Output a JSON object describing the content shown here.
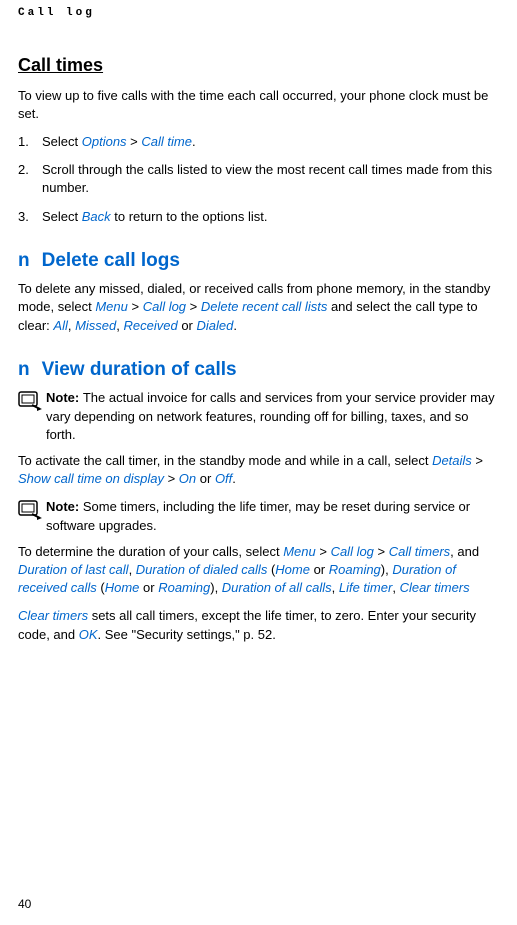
{
  "header": {
    "label": "Call log"
  },
  "sectionCallTimes": {
    "title": "Call times",
    "intro": "To view up to five calls with the time each call occurred, your phone clock must be set.",
    "steps": {
      "s1a": "Select ",
      "s1_options": "Options",
      "s1_gt": " > ",
      "s1_calltime": "Call time",
      "s1b": ".",
      "s2": "Scroll through the calls listed to view the most recent call times made from this number.",
      "s3a": "Select ",
      "s3_back": "Back",
      "s3b": " to return to the options list."
    }
  },
  "sectionDelete": {
    "bullet": "n",
    "title": "Delete call logs",
    "p1a": "To delete any missed, dialed, or received calls from phone memory, in the standby mode, select ",
    "p1_menu": "Menu",
    "p1_gt1": " > ",
    "p1_calllog": "Call log",
    "p1_gt2": " > ",
    "p1_delete": "Delete recent call lists",
    "p1b": " and select the call type to clear: ",
    "p1_all": "All",
    "p1_c1": ", ",
    "p1_missed": "Missed",
    "p1_c2": ", ",
    "p1_received": "Received",
    "p1_or": " or ",
    "p1_dialed": "Dialed",
    "p1c": "."
  },
  "sectionDuration": {
    "bullet": "n",
    "title": "View duration of calls",
    "note1_label": "Note: ",
    "note1_text": "The actual invoice for calls and services from your service provider may vary depending on network features, rounding off for billing, taxes, and so forth.",
    "p1a": "To activate the call timer, in the standby mode and while in a call, select ",
    "p1_details": "Details",
    "p1_gt1": " > ",
    "p1_show": "Show call time on display",
    "p1_gt2": " > ",
    "p1_on": "On",
    "p1_or": " or ",
    "p1_off": "Off",
    "p1b": ".",
    "note2_label": "Note: ",
    "note2_text": "Some timers, including the life timer, may be reset during service or software upgrades.",
    "p2a": "To determine the duration of your calls, select ",
    "p2_menu": "Menu",
    "p2_gt1": " > ",
    "p2_calllog": "Call log",
    "p2_gt2": " > ",
    "p2_timers": "Call timers",
    "p2b": ", and ",
    "p2_last": "Duration of last call",
    "p2_c1": ", ",
    "p2_dialed": "Duration of dialed calls",
    "p2_lp1": " (",
    "p2_home1": "Home",
    "p2_or1": " or ",
    "p2_roam1": "Roaming",
    "p2_rp1": "), ",
    "p2_recv": "Duration of received calls",
    "p2_lp2": " (",
    "p2_home2": "Home",
    "p2_or2": " or ",
    "p2_roam2": "Roaming",
    "p2_rp2": "), ",
    "p2_all": "Duration of all calls",
    "p2_c2": ", ",
    "p2_life": "Life timer",
    "p2_c3": ", ",
    "p2_clear": "Clear timers",
    "p3_clear": "Clear timers",
    "p3a": " sets all call timers, except the life timer, to zero. Enter your security code, and ",
    "p3_ok": "OK",
    "p3b": ". See \"Security settings,\" p. 52."
  },
  "pageNumber": "40"
}
